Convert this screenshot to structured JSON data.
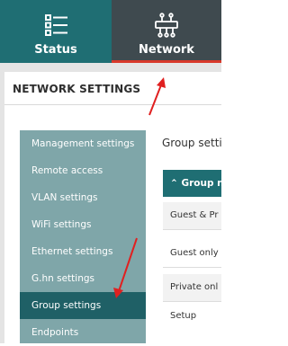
{
  "topnav": {
    "tabs": [
      {
        "label": "Status",
        "icon": "status-list-icon",
        "active": false
      },
      {
        "label": "Network",
        "icon": "network-icon",
        "active": true
      }
    ],
    "active_underline_color": "#d8392b"
  },
  "page": {
    "title": "NETWORK SETTINGS"
  },
  "sidebar": {
    "items": [
      {
        "label": "Management settings"
      },
      {
        "label": "Remote access"
      },
      {
        "label": "VLAN settings"
      },
      {
        "label": "WiFi settings"
      },
      {
        "label": "Ethernet settings"
      },
      {
        "label": "G.hn settings"
      },
      {
        "label": "Group settings",
        "active": true
      },
      {
        "label": "Endpoints"
      }
    ],
    "background": "#7fa6a9",
    "active_background": "#1f6066"
  },
  "content": {
    "title": "Group setti",
    "group_header": "Group n",
    "rows": [
      "Guest & Pr",
      "Guest only",
      "Private onl",
      "Setup"
    ]
  },
  "annotations": {
    "arrow_color": "#e02020"
  }
}
